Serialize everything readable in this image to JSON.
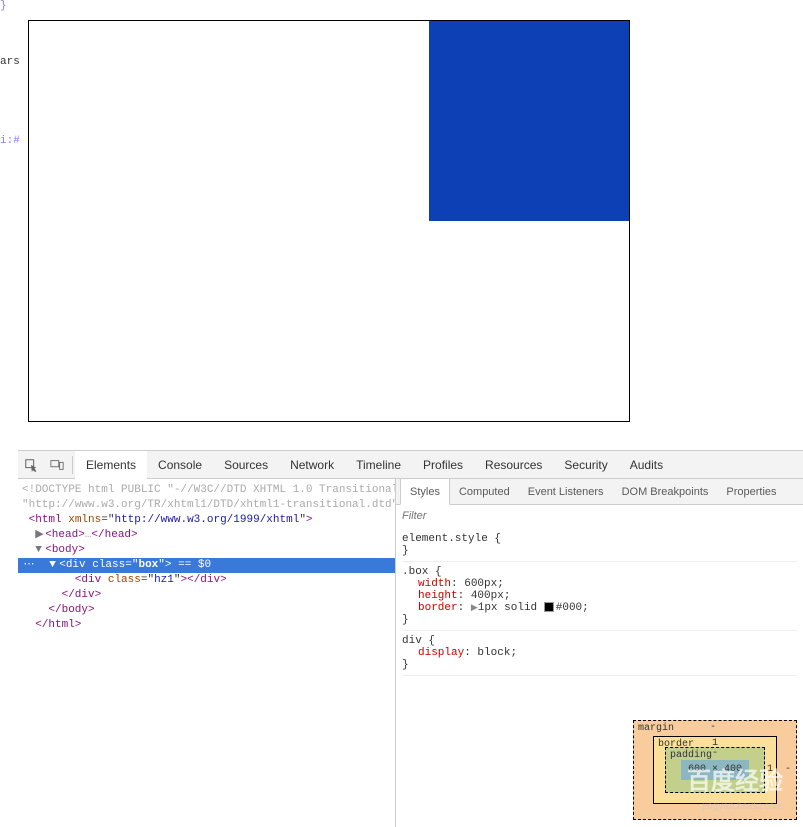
{
  "gutter": {
    "f1": "}",
    "f2": "ars",
    "f3": "i:#"
  },
  "main_tabs": [
    "Elements",
    "Console",
    "Sources",
    "Network",
    "Timeline",
    "Profiles",
    "Resources",
    "Security",
    "Audits"
  ],
  "main_tabs_active": 0,
  "dom_tree": {
    "doctype1": "<!DOCTYPE html PUBLIC \"-//W3C//DTD XHTML 1.0 Transitional//EN\"",
    "doctype2": "\"http://www.w3.org/TR/xhtml1/DTD/xhtml1-transitional.dtd\">",
    "html_open_tag": "html",
    "html_attr": "xmlns",
    "html_attrv": "http://www.w3.org/1999/xhtml",
    "head": "<head>…</head>",
    "body_open": "body",
    "sel_tag": "div",
    "sel_attr": "class",
    "sel_val": "box",
    "sel_suffix": " == $0",
    "child_tag": "div",
    "child_attr": "class",
    "child_val": "hz1",
    "close_div": "</div>",
    "close_body": "</body>",
    "close_html": "</html>"
  },
  "styles_tabs": [
    "Styles",
    "Computed",
    "Event Listeners",
    "DOM Breakpoints",
    "Properties"
  ],
  "styles_tabs_active": 0,
  "filter_placeholder": "Filter",
  "rules": {
    "r1": {
      "selector": "element.style",
      "open": " {",
      "close": "}"
    },
    "r2": {
      "selector": ".box",
      "open": " {",
      "close": "}",
      "p1n": "width",
      "p1v": "600px",
      "p2n": "height",
      "p2v": "400px",
      "p3n": "border",
      "p3v_pre": "1px solid ",
      "p3v_color": "#000"
    },
    "r3": {
      "selector": "div",
      "open": " {",
      "close": "}",
      "p1n": "display",
      "p1v": "block"
    }
  },
  "box_model": {
    "margin_label": "margin",
    "margin_val": "-",
    "border_label": "border",
    "border_val": "1",
    "padding_label": "padding",
    "padding_val": "-",
    "content": "600 × 400",
    "right1": "1",
    "right2": "-"
  },
  "watermark": {
    "main": "百度经验",
    "sub": "jingyan.baidu.com"
  }
}
